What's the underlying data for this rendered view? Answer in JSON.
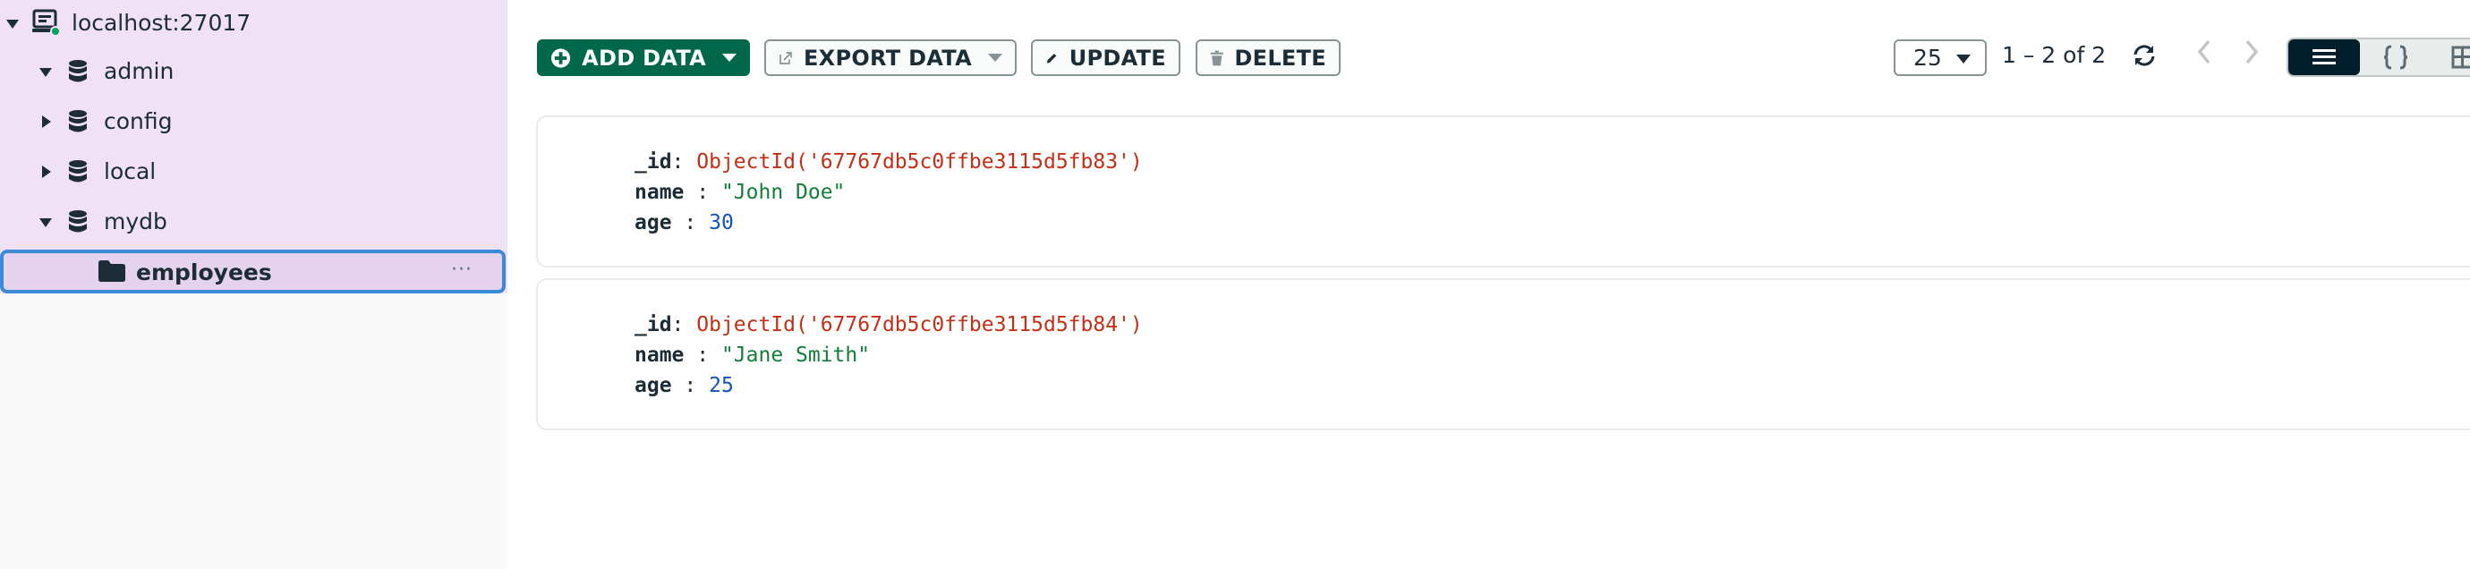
{
  "sidebar": {
    "connection": {
      "label": "localhost:27017",
      "status_color": "#00a35c"
    },
    "databases": [
      {
        "name": "admin",
        "expanded": true
      },
      {
        "name": "config",
        "expanded": false
      },
      {
        "name": "local",
        "expanded": false
      },
      {
        "name": "mydb",
        "expanded": true
      }
    ],
    "selected_collection": {
      "label": "employees",
      "more_label": "···"
    }
  },
  "toolbar": {
    "add_data_label": "ADD DATA",
    "export_data_label": "EXPORT DATA",
    "update_label": "UPDATE",
    "delete_label": "DELETE",
    "page_size": "25",
    "range_text": "1 – 2 of 2"
  },
  "documents": [
    {
      "id_key": "_id",
      "id_value": "ObjectId('67767db5c0ffbe3115d5fb83')",
      "name_key": "name",
      "name_value": "\"John Doe\"",
      "age_key": "age",
      "age_value": "30"
    },
    {
      "id_key": "_id",
      "id_value": "ObjectId('67767db5c0ffbe3115d5fb84')",
      "name_key": "name",
      "name_value": "\"Jane Smith\"",
      "age_key": "age",
      "age_value": "25"
    }
  ],
  "colors": {
    "accent_green": "#00684a",
    "selection_blue": "#3a8ad8",
    "sidebar_highlight": "#f0e1f5",
    "oid_red": "#c32f17",
    "string_green": "#137d3b",
    "number_blue": "#1254b7"
  }
}
